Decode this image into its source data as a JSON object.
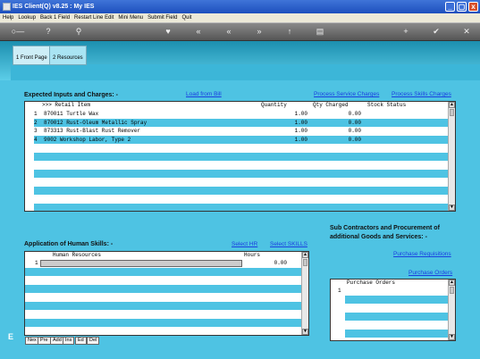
{
  "window": {
    "title": "IES Client(Q) v8.25 : My IES",
    "min": "_",
    "max": "▢",
    "close": "x"
  },
  "menu": [
    "Help",
    "Lookup",
    "Back 1 Field",
    "Restart Line Edit",
    "Mini Menu",
    "Submit Field",
    "Quit"
  ],
  "toolbar": {
    "key": "○—",
    "help": "?",
    "search": "⚲",
    "heart": "♥",
    "back2": "«",
    "fwd2": "»",
    "up": "↑",
    "doc": "▤",
    "add": "+",
    "ok": "✔",
    "close": "✕"
  },
  "tabs": [
    {
      "label": "1 Front Page"
    },
    {
      "label": "2 Resources"
    }
  ],
  "inputs": {
    "title": "Expected Inputs and Charges: -",
    "links": {
      "load_from_bill": "Load from Bill",
      "process_service_charges": "Process Service Charges",
      "process_skills_charges": "Process Skills Charges"
    },
    "columns": {
      "item": ">>> Retail Item",
      "quantity": "Quantity",
      "qty_charged": "Qty Charged",
      "stock_status": "Stock Status"
    },
    "rows": [
      {
        "n": "1",
        "item": "870011 Turtle Wax",
        "qty": "1.00",
        "charged": "0.00"
      },
      {
        "n": "2",
        "item": "870012 Rust-Oleum Metallic Spray",
        "qty": "1.00",
        "charged": "0.00"
      },
      {
        "n": "3",
        "item": "873313 Rust-Blast Rust Remover",
        "qty": "1.00",
        "charged": "0.00"
      },
      {
        "n": "4",
        "item": "9002 Workshop Labor, Type 2",
        "qty": "1.00",
        "charged": "0.00"
      }
    ]
  },
  "skills": {
    "title": "Application of Human Skills: -",
    "links": {
      "select_hr": "Select HR",
      "select_skills": "Select SKILLS"
    },
    "columns": {
      "resource": "Human Resources",
      "hours": "Hours"
    },
    "rows": [
      {
        "n": "1",
        "hours": "0.00"
      }
    ],
    "nav": [
      "Nex",
      "Pre",
      "Add",
      "Ins",
      "Ed",
      "Del"
    ],
    "e_label": "E"
  },
  "subcontract": {
    "title": "Sub Contractors and Procurement of additional Goods and Services: -",
    "links": {
      "purchase_requisitions": "Purchase Requisitions",
      "purchase_orders": "Purchase Orders"
    },
    "column": "Purchase Orders",
    "rows": [
      {
        "n": "1"
      }
    ]
  }
}
